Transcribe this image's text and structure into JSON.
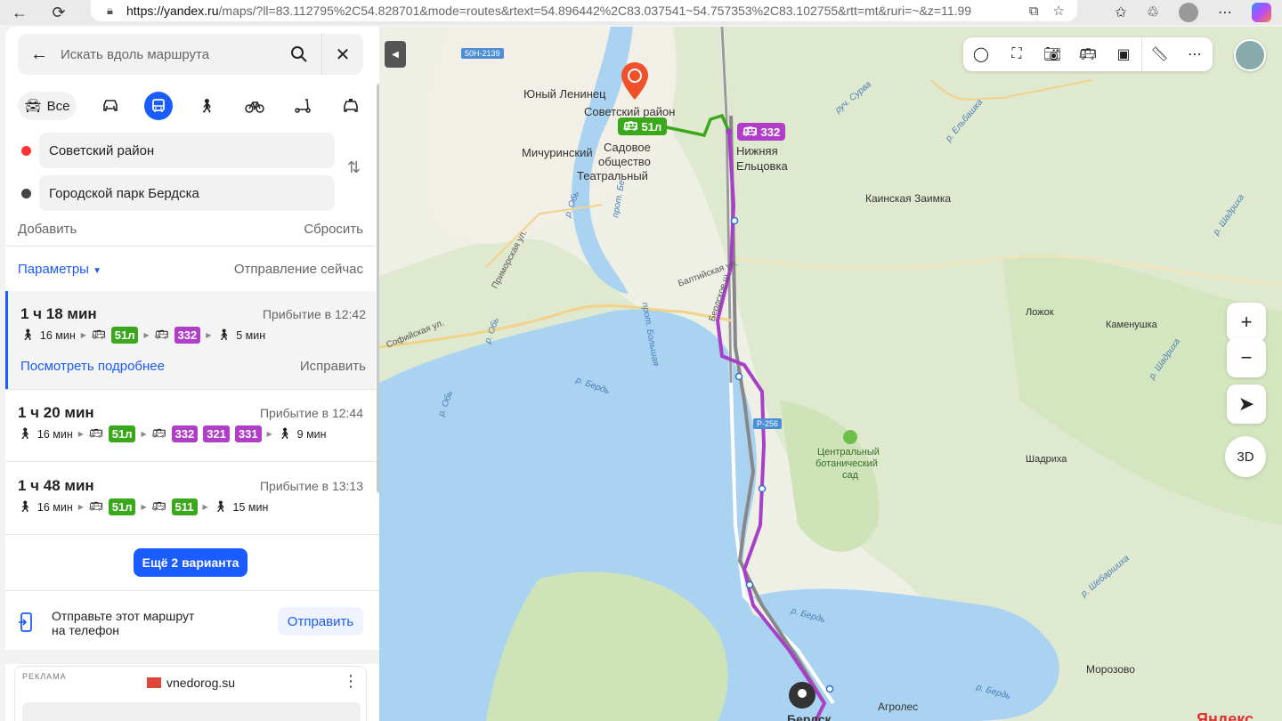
{
  "browser": {
    "url_host": "https://yandex.ru",
    "url_rest": "/maps/?ll=83.112795%2C54.828701&mode=routes&rtext=54.896442%2C83.037541~54.757353%2C83.102755&rtt=mt&ruri=~&z=11.99"
  },
  "sidebar": {
    "search_placeholder": "Искать вдоль маршрута",
    "modes": {
      "all_label": "Все"
    },
    "from": "Советский район",
    "to": "Городской парк Бердска",
    "add": "Добавить",
    "reset": "Сбросить",
    "params": "Параметры",
    "departure": "Отправление сейчас",
    "routes": [
      {
        "duration": "1 ч 18 мин",
        "arrival": "Прибытие в 12:42",
        "walk1": "16 мин",
        "lines_a": [
          "51л"
        ],
        "lines_b": [
          "332"
        ],
        "walk2": "5 мин",
        "details": "Посмотреть подробнее",
        "fix": "Исправить"
      },
      {
        "duration": "1 ч 20 мин",
        "arrival": "Прибытие в 12:44",
        "walk1": "16 мин",
        "lines_a": [
          "51л"
        ],
        "lines_b": [
          "332",
          "321",
          "331"
        ],
        "walk2": "9 мин"
      },
      {
        "duration": "1 ч 48 мин",
        "arrival": "Прибытие в 13:13",
        "walk1": "16 мин",
        "lines_a": [
          "51л"
        ],
        "lines_b": [
          "511"
        ],
        "walk2": "15 мин"
      }
    ],
    "more_variants": "Ещё 2 варианта",
    "send_text_1": "Отправьте этот маршрут",
    "send_text_2": "на телефон",
    "send_button": "Отправить",
    "ad_label": "РЕКЛАМА",
    "ad_site": "vnedorog.su"
  },
  "map": {
    "labels": {
      "sovetsky": "Советский район",
      "yuny": "Юный Ленинец",
      "michurinsky": "Мичуринский",
      "sadovoe1": "Садовое",
      "sadovoe2": "общество",
      "sadovoe3": "Театральный",
      "nizhnyaya1": "Нижняя",
      "nizhnyaya2": "Ельцовка",
      "kainskaya": "Каинская Заимка",
      "lozhok": "Ложок",
      "kamenushka": "Каменушка",
      "botan1": "Центральный",
      "botan2": "ботанический",
      "botan3": "сад",
      "shadrikha": "Шадриха",
      "morozovo": "Морозово",
      "agroles": "Агролес",
      "berdsk": "Бердск"
    },
    "roads": {
      "r50n": "50Н-2139",
      "r256": "Р-256",
      "primorskaya": "Приморская ул.",
      "sofiyskaya": "Софийская ул.",
      "baltiyskaya": "Балтийская ул.",
      "berdskoe": "Бердское ш.",
      "bolshaya": "прот. Большая",
      "be": "прот. Бе"
    },
    "rivers": {
      "ob1": "р. Обь",
      "ob2": "р. Обь",
      "ob3": "р. Обь",
      "berd1": "р. Бердь",
      "berd2": "р. Бердь",
      "berd3": "р. Бердь",
      "elbashka": "р. Ельбашка",
      "sura": "руч. Сурва",
      "shadriha": "р. Шадриха",
      "shadriha2": "р. Шадриха",
      "shebarshikha": "р. Шебаршиха"
    },
    "transit": {
      "green": "51л",
      "purple": "332"
    },
    "zoom_in": "+",
    "zoom_out": "−",
    "three_d": "3D",
    "logo": "Яндекс"
  }
}
